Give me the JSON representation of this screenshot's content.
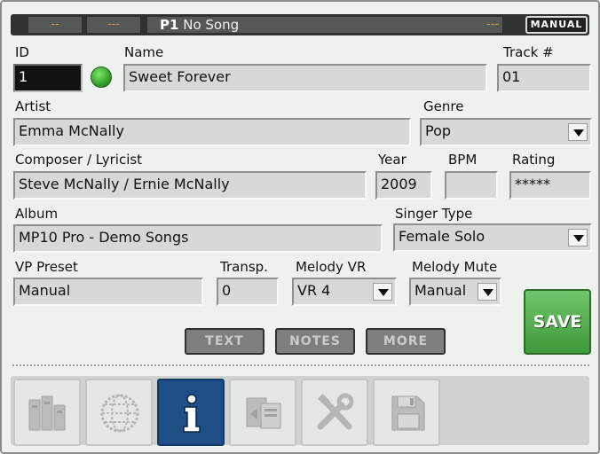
{
  "header": {
    "left_seg1": "--",
    "left_seg2": "---",
    "pad_label": "P1",
    "song_status": "No Song",
    "right_seg": "---",
    "mode_button": "MANUAL"
  },
  "labels": {
    "id": "ID",
    "name": "Name",
    "track": "Track #",
    "artist": "Artist",
    "genre": "Genre",
    "composer": "Composer / Lyricist",
    "year": "Year",
    "bpm": "BPM",
    "rating": "Rating",
    "album": "Album",
    "singer_type": "Singer Type",
    "vp_preset": "VP Preset",
    "transp": "Transp.",
    "melody_vr": "Melody VR",
    "melody_mute": "Melody Mute"
  },
  "values": {
    "id": "1",
    "name": "Sweet Forever",
    "track": "01",
    "artist": "Emma McNally",
    "genre": "Pop",
    "composer": "Steve McNally / Ernie McNally",
    "year": "2009",
    "bpm": "",
    "rating": "*****",
    "album": "MP10 Pro - Demo Songs",
    "singer_type": "Female Solo",
    "vp_preset": "Manual",
    "transp": "0",
    "melody_vr": "VR 4",
    "melody_mute": "Manual"
  },
  "buttons": {
    "text": "TEXT",
    "notes": "NOTES",
    "more": "MORE",
    "save": "SAVE"
  },
  "status_led": {
    "color": "#3fb233",
    "state": "on"
  },
  "tabs": [
    {
      "icon": "library-icon",
      "active": false
    },
    {
      "icon": "globe-icon",
      "active": false
    },
    {
      "icon": "info-icon",
      "active": true
    },
    {
      "icon": "copy-icon",
      "active": false
    },
    {
      "icon": "tools-icon",
      "active": false
    },
    {
      "icon": "floppy-disk-icon",
      "active": false
    }
  ],
  "colors": {
    "background": "#eef2ee",
    "field": "#d6dad6",
    "save_green": "#4fae4a",
    "active_tab": "#1d4f86"
  }
}
